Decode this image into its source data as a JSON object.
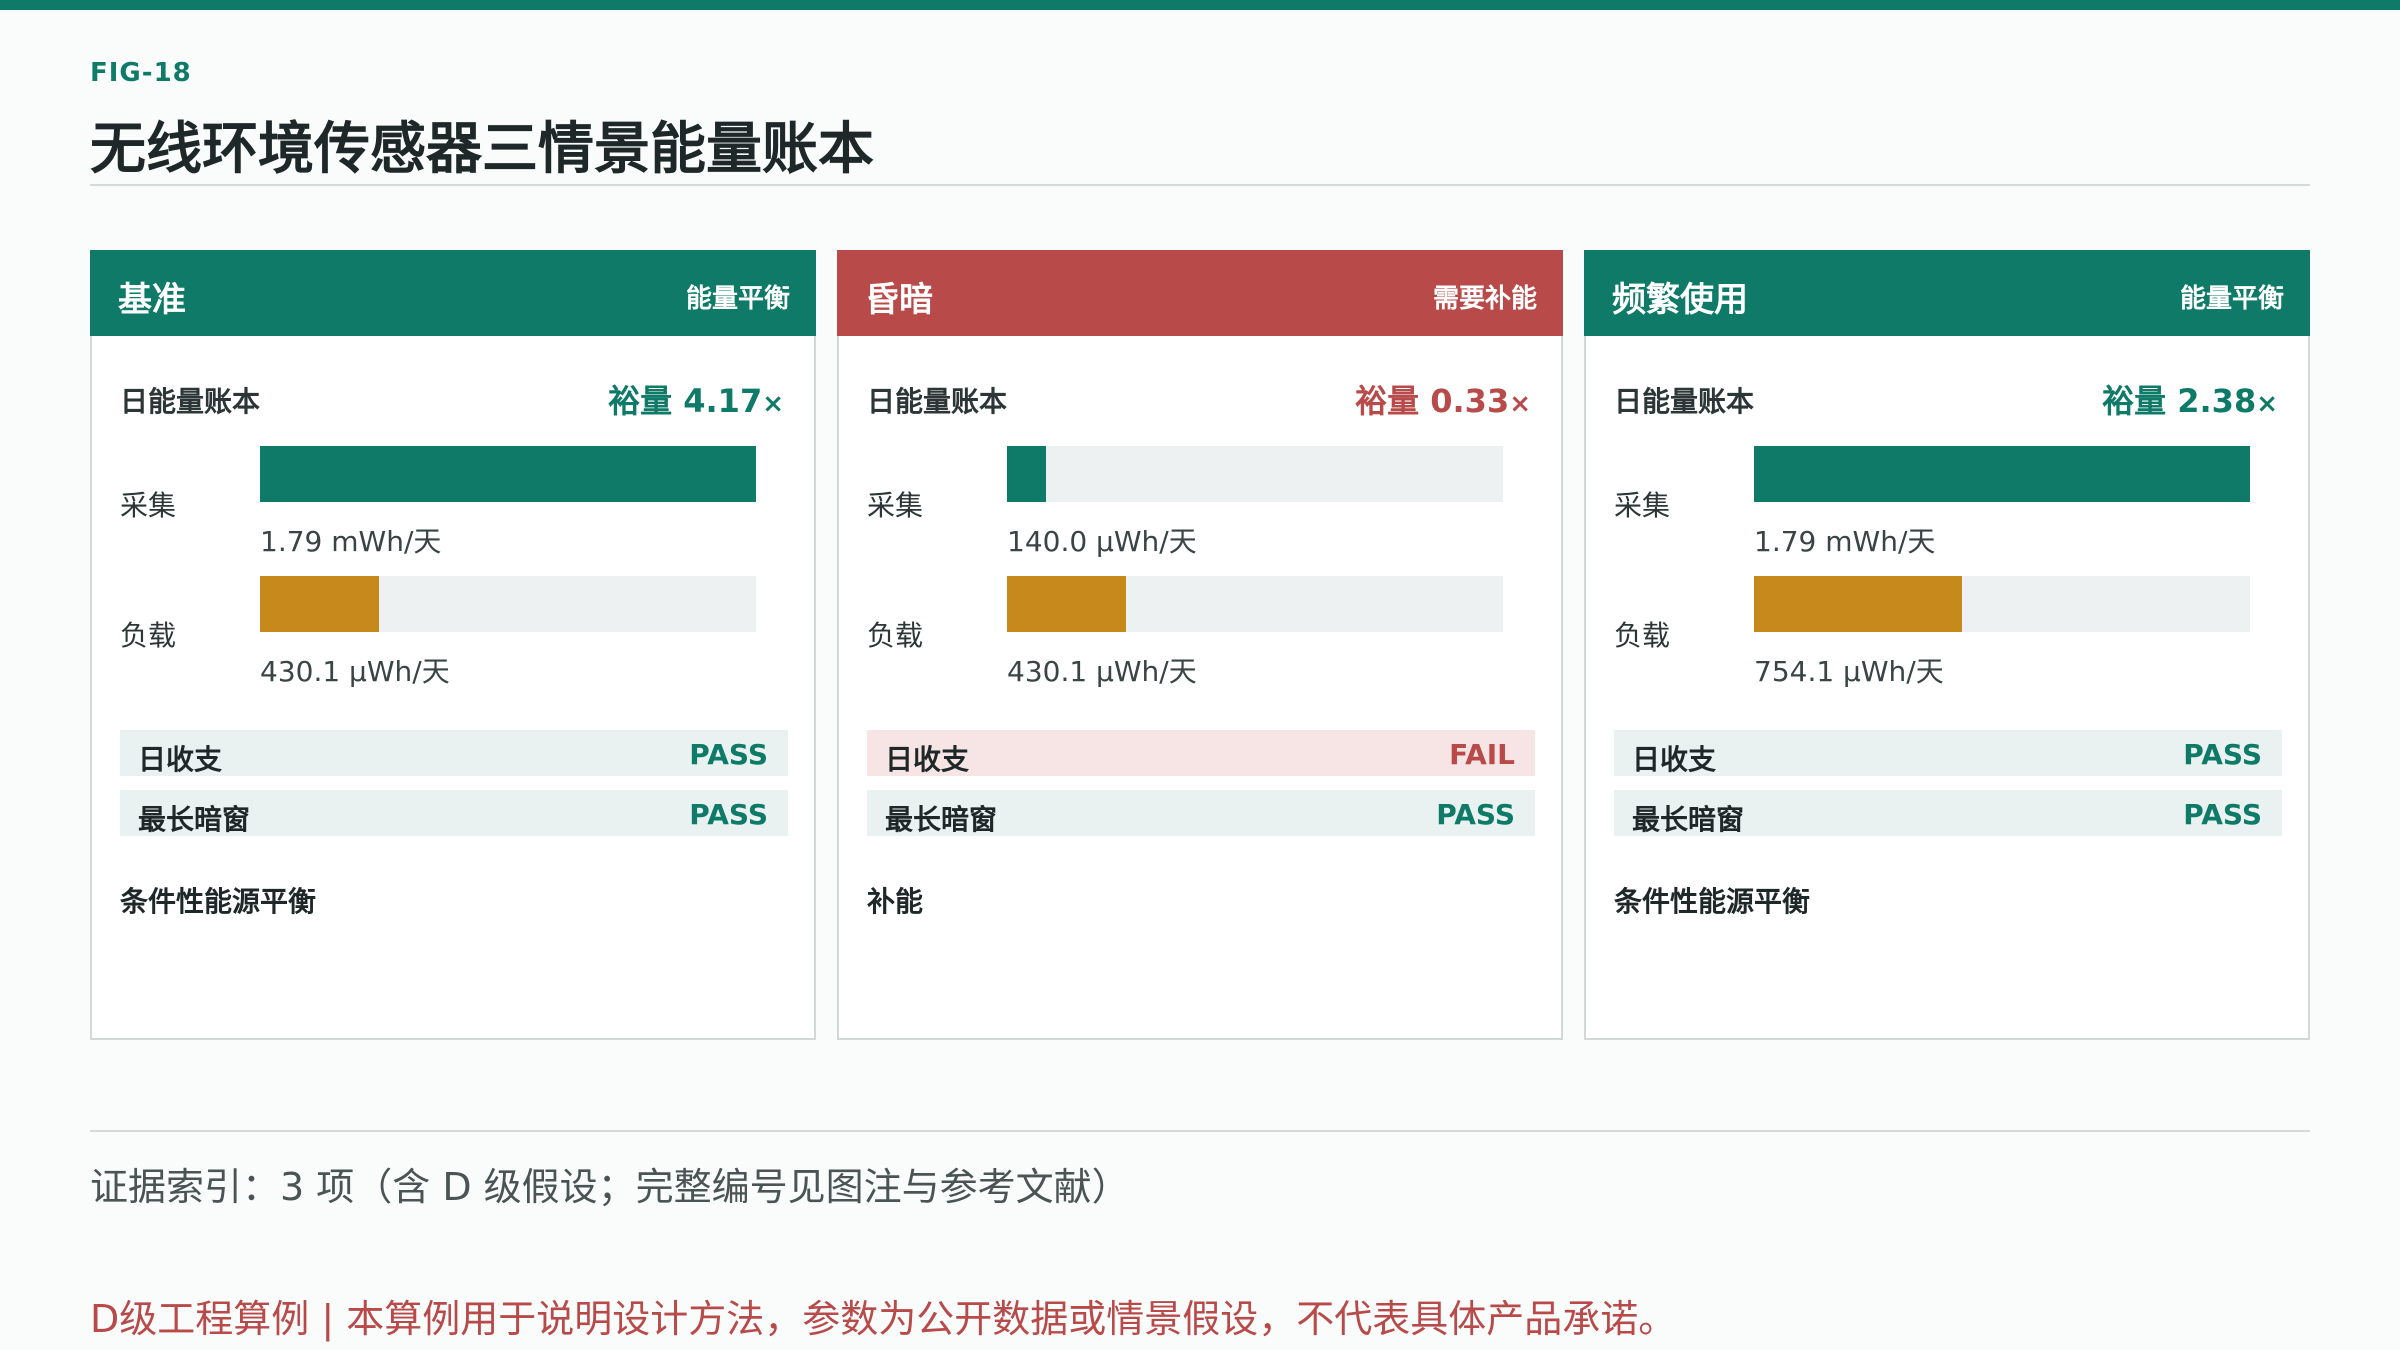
{
  "header": {
    "fig_id": "FIG-18",
    "title": "无线环境传感器三情景能量账本"
  },
  "labels": {
    "ledger": "日能量账本",
    "margin_prefix": "裕量",
    "margin_suffix": "×",
    "harvest": "采集",
    "load": "负载",
    "daily_balance": "日收支",
    "longest_dark": "最长暗窗"
  },
  "colors": {
    "ok": "#0e7a67",
    "bad": "#b84a4a",
    "load": "#c8891c"
  },
  "chart_data": {
    "type": "bar",
    "categories": [
      "采集",
      "负载"
    ],
    "panels": [
      {
        "name": "基准",
        "status": "能量平衡",
        "status_ok": true,
        "margin": "4.17",
        "harvest_fraction": 1.0,
        "load_fraction": 0.24,
        "harvest_text": "1.79 mWh/天",
        "load_text": "430.1 μWh/天",
        "daily_balance": "PASS",
        "longest_dark": "PASS",
        "verdict": "条件性能源平衡"
      },
      {
        "name": "昏暗",
        "status": "需要补能",
        "status_ok": false,
        "margin": "0.33",
        "harvest_fraction": 0.078,
        "load_fraction": 0.24,
        "harvest_text": "140.0 μWh/天",
        "load_text": "430.1 μWh/天",
        "daily_balance": "FAIL",
        "longest_dark": "PASS",
        "verdict": "补能"
      },
      {
        "name": "频繁使用",
        "status": "能量平衡",
        "status_ok": true,
        "margin": "2.38",
        "harvest_fraction": 1.0,
        "load_fraction": 0.42,
        "harvest_text": "1.79 mWh/天",
        "load_text": "754.1 μWh/天",
        "daily_balance": "PASS",
        "longest_dark": "PASS",
        "verdict": "条件性能源平衡"
      }
    ]
  },
  "footer": {
    "evidence": "证据索引：3 项（含 D 级假设；完整编号见图注与参考文献）",
    "disclaimer": "D级工程算例 | 本算例用于说明设计方法，参数为公开数据或情景假设，不代表具体产品承诺。"
  }
}
